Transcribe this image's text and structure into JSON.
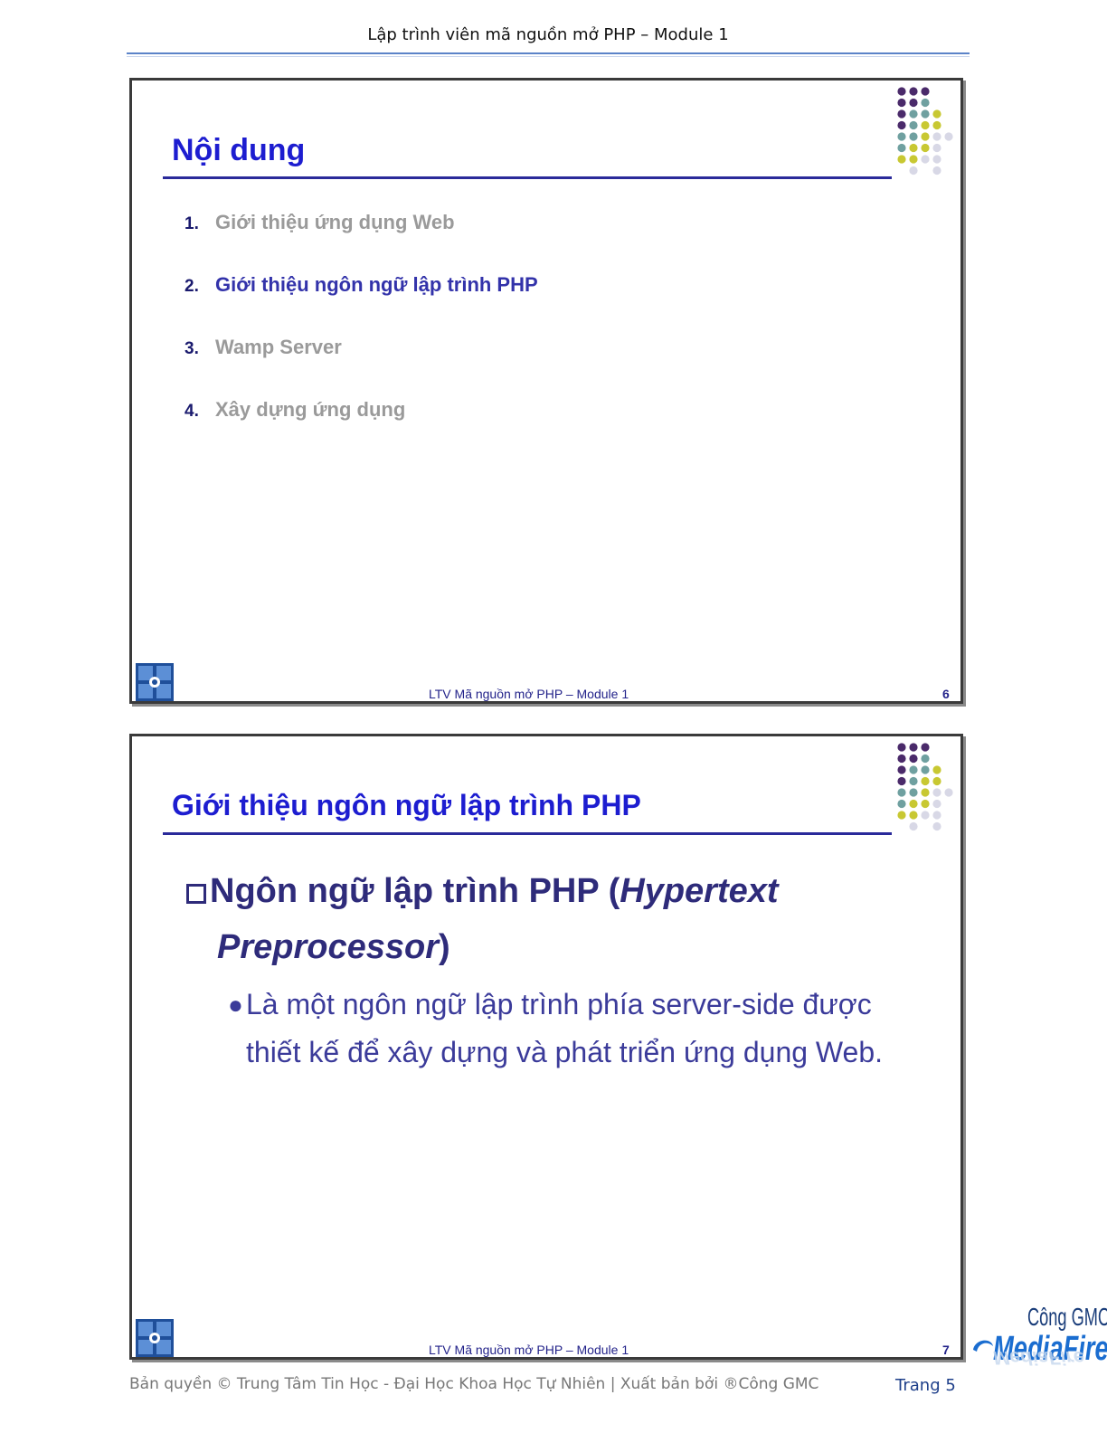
{
  "header": {
    "title": "Lập trình viên mã nguồn mở PHP – Module 1"
  },
  "slides": [
    {
      "title": "Nội dung",
      "items": [
        {
          "num": "1.",
          "label": "Giới thiệu ứng dụng Web"
        },
        {
          "num": "2.",
          "label": "Giới thiệu ngôn ngữ lập trình PHP"
        },
        {
          "num": "3.",
          "label": "Wamp Server"
        },
        {
          "num": "4.",
          "label": "Xây dựng ứng dụng"
        }
      ],
      "footer": "LTV Mã nguồn mở PHP – Module 1",
      "number": "6"
    },
    {
      "title": "Giới thiệu ngôn ngữ lập trình PHP",
      "bullet_main_a": "Ngôn ngữ lập trình PHP (",
      "bullet_main_b": "Hypertext",
      "bullet_main_c": "Preprocessor",
      "bullet_main_d": ")",
      "bullet_sub": "Là một ngôn ngữ lập trình phía server-side được thiết kế để xây dựng và phát triển ứng dụng Web.",
      "footer": "LTV Mã nguồn mở PHP – Module 1",
      "number": "7"
    }
  ],
  "footer": {
    "copyright": "Bản quyền © Trung Tâm Tin Học - Đại Học Khoa Học Tự Nhiên | Xuất bản bởi ®Công GMC",
    "page": "Trang 5"
  },
  "badge": {
    "top": "Công GMC",
    "main": "MediaFire"
  },
  "colors": {
    "title": "#1d1dd0",
    "dim_item": "#9a9a9a",
    "active_item": "#3333aa",
    "rule": "#2a2a9a"
  }
}
